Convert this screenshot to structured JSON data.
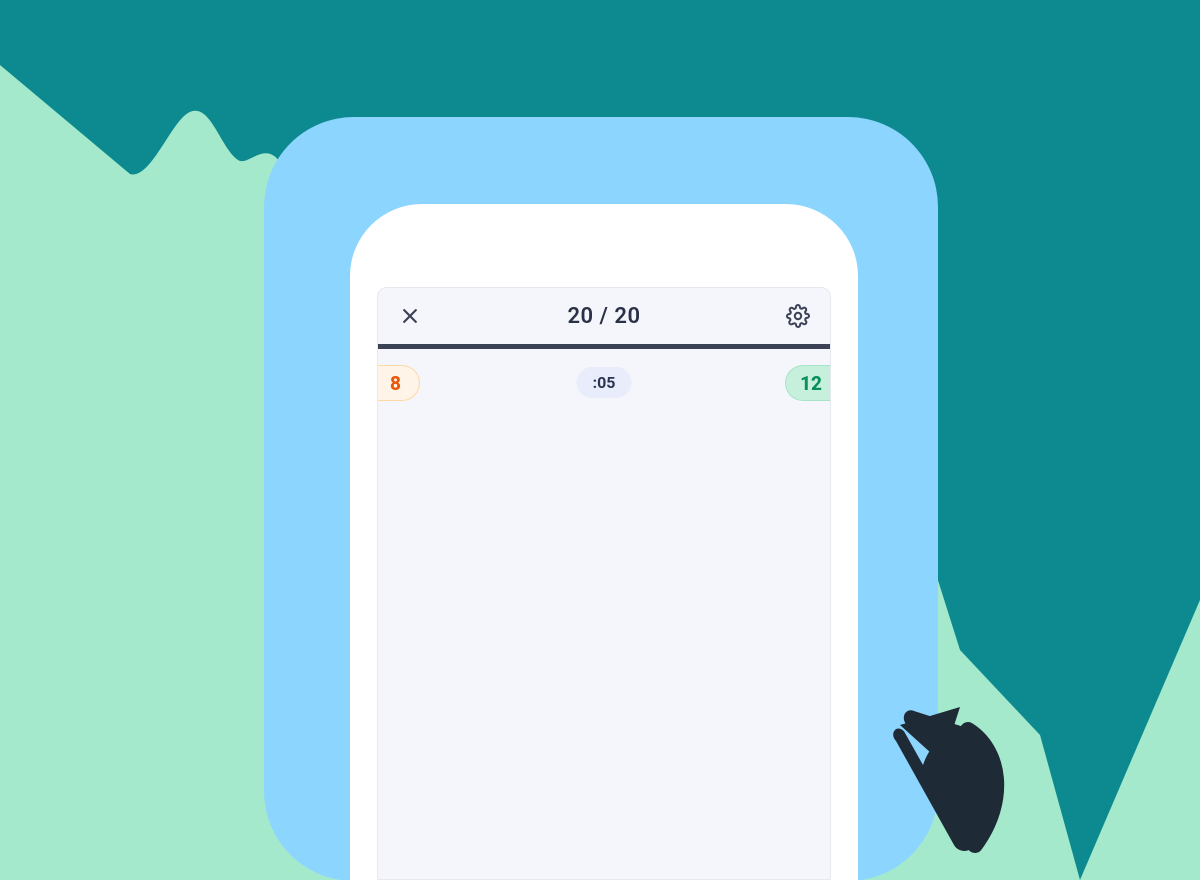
{
  "header": {
    "progress_label": "20 / 20"
  },
  "scores": {
    "left": "8",
    "right": "12"
  },
  "timer": {
    "label": ":05"
  },
  "icons": {
    "close": "close-icon",
    "settings": "gear-icon",
    "cursor": "cursor-arrow-icon"
  },
  "colors": {
    "bg_mint": "#a5e9cd",
    "bg_teal": "#0d8a8f",
    "device_blue": "#8bd5ff",
    "phone_white": "#ffffff",
    "app_bg": "#f4f6fb",
    "text_dark": "#2b3247",
    "progress_bar": "#3b4255",
    "left_pill_bg": "#fff4e8",
    "left_pill_text": "#e8590c",
    "right_pill_bg": "#c7f0dc",
    "right_pill_text": "#0a8f5b",
    "timer_bg": "#e9ecfb"
  }
}
